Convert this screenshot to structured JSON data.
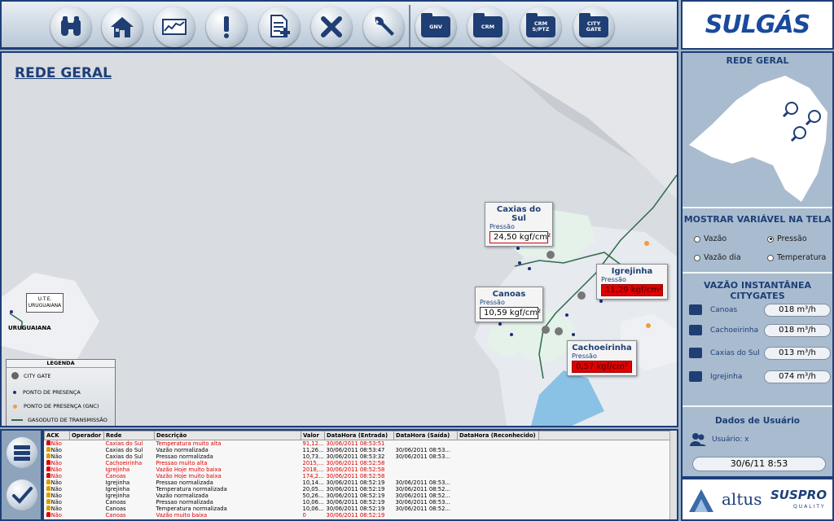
{
  "logo": {
    "text": "SULGÁS"
  },
  "toolbar": {
    "buttons": [
      "binoculars-icon",
      "home-icon",
      "trend-chart-icon",
      "alert-icon",
      "add-report-icon",
      "close-icon",
      "wrench-icon"
    ],
    "folders": [
      {
        "label": "GNV"
      },
      {
        "label": "CRM"
      },
      {
        "label": "CRM S/PTZ"
      },
      {
        "label": "CITY GATE"
      }
    ]
  },
  "map": {
    "title": "REDE GERAL",
    "cities": [
      {
        "name": "Caxias do Sul",
        "label": "Pressão",
        "value": "24,50  kgf/cm²",
        "state": "warn"
      },
      {
        "name": "Igrejinha",
        "label": "Pressão",
        "value": "11,29  kgf/cm²",
        "state": "alarm"
      },
      {
        "name": "Canoas",
        "label": "Pressão",
        "value": "10,59  kgf/cm²",
        "state": "normal"
      },
      {
        "name": "Cachoeirinha",
        "label": "Pressão",
        "value": "0,57  kgf/cm²",
        "state": "alarm"
      }
    ],
    "ute": {
      "label": "U.T.E. URUGUAIANA"
    },
    "uruguaiana": "URUGUAIANA",
    "legend": {
      "title": "LEGENDA",
      "items": [
        "CITY GATE",
        "PONTO DE PRESENÇA",
        "PONTO DE PRESENÇA (GNC)",
        "GASODUTO DE TRANSMISSÃO"
      ]
    }
  },
  "right_panel": {
    "overview_title": "REDE GERAL",
    "variable_title": "MOSTRAR VARIÁVEL NA TELA",
    "variables": [
      {
        "label": "Vazão",
        "selected": false
      },
      {
        "label": "Pressão",
        "selected": true
      },
      {
        "label": "Vazão dia",
        "selected": false
      },
      {
        "label": "Temperatura",
        "selected": false
      }
    ],
    "flow_title": "VAZÃO INSTANTÂNEA CITYGATES",
    "flows": [
      {
        "name": "Canoas",
        "value": "018 m³/h"
      },
      {
        "name": "Cachoeirinha",
        "value": "018 m³/h"
      },
      {
        "name": "Caxias do Sul",
        "value": "013 m³/h"
      },
      {
        "name": "Igrejinha",
        "value": "074 m³/h"
      }
    ],
    "user_title": "Dados de Usuário",
    "user_label": "Usuário: x",
    "datetime": "30/6/11 8:53"
  },
  "alarms": {
    "columns": [
      "ACK",
      "Operador",
      "Rede",
      "Descrição",
      "Valor",
      "DataHora (Entrada)",
      "DataHora (Saída)",
      "DataHora (Reconhecido)"
    ],
    "rows": [
      {
        "ack": "Não",
        "op": "",
        "rede": "Caxias do Sul",
        "desc": "Temperatura muito alta",
        "valor": "91,12...",
        "entrada": "30/06/2011 08:53:51",
        "saida": "",
        "rec": "",
        "red": true
      },
      {
        "ack": "Não",
        "op": "",
        "rede": "Caxias do Sul",
        "desc": "Vazão normalizada",
        "valor": "11,26...",
        "entrada": "30/06/2011 08:53:47",
        "saida": "30/06/2011 08:53...",
        "rec": "",
        "red": false
      },
      {
        "ack": "Não",
        "op": "",
        "rede": "Caxias do Sul",
        "desc": "Pressao normalizada",
        "valor": "10,73...",
        "entrada": "30/06/2011 08:53:32",
        "saida": "30/06/2011 08:53...",
        "rec": "",
        "red": false
      },
      {
        "ack": "Não",
        "op": "",
        "rede": "Cachoeirinha",
        "desc": "Pressao muito alta",
        "valor": "2015,...",
        "entrada": "30/06/2011 08:52:58",
        "saida": "",
        "rec": "",
        "red": true
      },
      {
        "ack": "Não",
        "op": "",
        "rede": "Igrejinha",
        "desc": "Vazão Hoje muito baixa",
        "valor": "2018,...",
        "entrada": "30/06/2011 08:52:58",
        "saida": "",
        "rec": "",
        "red": true
      },
      {
        "ack": "Não",
        "op": "",
        "rede": "Canoas",
        "desc": "Vazão Hoje muito baixa",
        "valor": "174,2...",
        "entrada": "30/06/2011 08:52:58",
        "saida": "",
        "rec": "",
        "red": true
      },
      {
        "ack": "Não",
        "op": "",
        "rede": "Igrejinha",
        "desc": "Pressao normalizada",
        "valor": "10,14...",
        "entrada": "30/06/2011 08:52:19",
        "saida": "30/06/2011 08:53...",
        "rec": "",
        "red": false
      },
      {
        "ack": "Não",
        "op": "",
        "rede": "Igrejinha",
        "desc": "Temperatura normalizada",
        "valor": "20,05...",
        "entrada": "30/06/2011 08:52:19",
        "saida": "30/06/2011 08:52...",
        "rec": "",
        "red": false
      },
      {
        "ack": "Não",
        "op": "",
        "rede": "Igrejinha",
        "desc": "Vazão normalizada",
        "valor": "50,26...",
        "entrada": "30/06/2011 08:52:19",
        "saida": "30/06/2011 08:52...",
        "rec": "",
        "red": false
      },
      {
        "ack": "Não",
        "op": "",
        "rede": "Canoas",
        "desc": "Pressao normalizada",
        "valor": "10,06...",
        "entrada": "30/06/2011 08:52:19",
        "saida": "30/06/2011 08:53...",
        "rec": "",
        "red": false
      },
      {
        "ack": "Não",
        "op": "",
        "rede": "Canoas",
        "desc": "Temperatura normalizada",
        "valor": "10,06...",
        "entrada": "30/06/2011 08:52:19",
        "saida": "30/06/2011 08:52...",
        "rec": "",
        "red": false
      },
      {
        "ack": "Não",
        "op": "",
        "rede": "Canoas",
        "desc": "Vazão muito baixa",
        "valor": "0",
        "entrada": "30/06/2011 08:52:19",
        "saida": "",
        "rec": "",
        "red": true
      }
    ]
  },
  "bottom_logos": {
    "left": "altus",
    "right": "SUSPRO",
    "right_sub": "QUALITY"
  }
}
